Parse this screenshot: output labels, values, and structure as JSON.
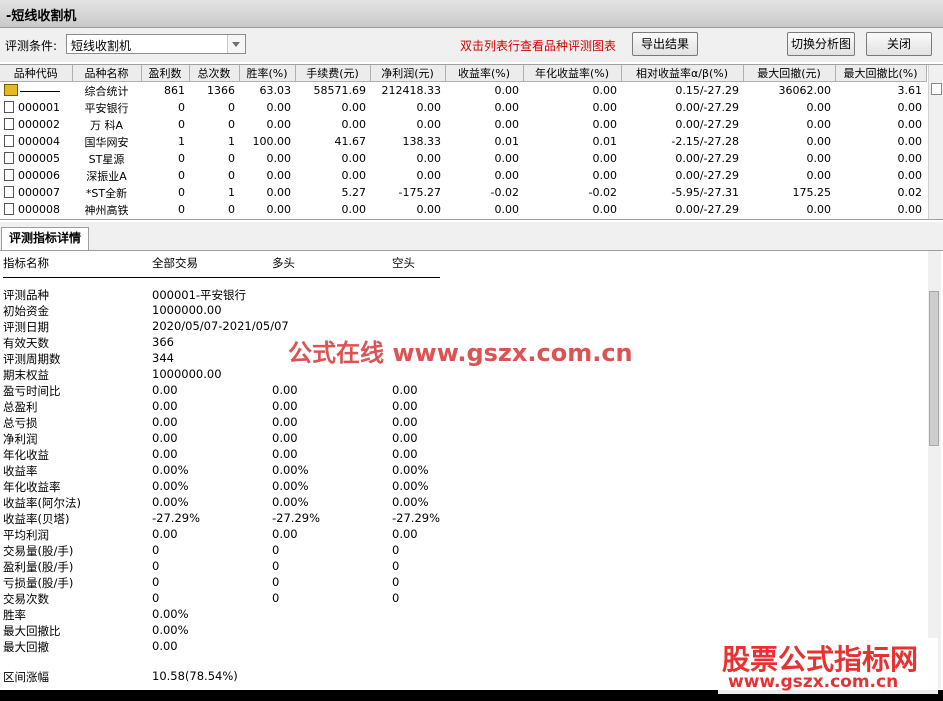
{
  "window": {
    "title": "-短线收割机"
  },
  "toolbar": {
    "condition_label": "评测条件:",
    "condition_value": "短线收割机",
    "hint": "双击列表行查看品种评测图表",
    "export_label": "导出结果",
    "switch_label": "切换分析图",
    "close_label": "关闭"
  },
  "table": {
    "headers": [
      "品种代码",
      "品种名称",
      "盈利数",
      "总次数",
      "胜率(%)",
      "手续费(元)",
      "净利润(元)",
      "收益率(%)",
      "年化收益率(%)",
      "相对收益率α/β(%)",
      "最大回撤(元)",
      "最大回撤比(%)"
    ],
    "rows": [
      [
        "",
        "综合统计",
        "861",
        "1366",
        "63.03",
        "58571.69",
        "212418.33",
        "0.00",
        "0.00",
        "0.15/-27.29",
        "36062.00",
        "3.61"
      ],
      [
        "000001",
        "平安银行",
        "0",
        "0",
        "0.00",
        "0.00",
        "0.00",
        "0.00",
        "0.00",
        "0.00/-27.29",
        "0.00",
        "0.00"
      ],
      [
        "000002",
        "万 科A",
        "0",
        "0",
        "0.00",
        "0.00",
        "0.00",
        "0.00",
        "0.00",
        "0.00/-27.29",
        "0.00",
        "0.00"
      ],
      [
        "000004",
        "国华网安",
        "1",
        "1",
        "100.00",
        "41.67",
        "138.33",
        "0.01",
        "0.01",
        "-2.15/-27.28",
        "0.00",
        "0.00"
      ],
      [
        "000005",
        "ST星源",
        "0",
        "0",
        "0.00",
        "0.00",
        "0.00",
        "0.00",
        "0.00",
        "0.00/-27.29",
        "0.00",
        "0.00"
      ],
      [
        "000006",
        "深振业A",
        "0",
        "0",
        "0.00",
        "0.00",
        "0.00",
        "0.00",
        "0.00",
        "0.00/-27.29",
        "0.00",
        "0.00"
      ],
      [
        "000007",
        "*ST全新",
        "0",
        "1",
        "0.00",
        "5.27",
        "-175.27",
        "-0.02",
        "-0.02",
        "-5.95/-27.31",
        "175.25",
        "0.02"
      ],
      [
        "000008",
        "神州高铁",
        "0",
        "0",
        "0.00",
        "0.00",
        "0.00",
        "0.00",
        "0.00",
        "0.00/-27.29",
        "0.00",
        "0.00"
      ]
    ]
  },
  "detail": {
    "tab_label": "评测指标详情",
    "headers": [
      "指标名称",
      "全部交易",
      "多头",
      "空头"
    ],
    "rows": [
      [
        "评测品种",
        "000001-平安银行",
        "",
        ""
      ],
      [
        "初始资金",
        "1000000.00",
        "",
        ""
      ],
      [
        "评测日期",
        "2020/05/07-2021/05/07",
        "",
        ""
      ],
      [
        "有效天数",
        "366",
        "",
        ""
      ],
      [
        "评测周期数",
        "344",
        "",
        ""
      ],
      [
        "期末权益",
        "1000000.00",
        "",
        ""
      ],
      [
        "盈亏时间比",
        "0.00",
        "0.00",
        "0.00"
      ],
      [
        "总盈利",
        "0.00",
        "0.00",
        "0.00"
      ],
      [
        "总亏损",
        "0.00",
        "0.00",
        "0.00"
      ],
      [
        "净利润",
        "0.00",
        "0.00",
        "0.00"
      ],
      [
        "年化收益",
        "0.00",
        "0.00",
        "0.00"
      ],
      [
        "收益率",
        "0.00%",
        "0.00%",
        "0.00%"
      ],
      [
        "年化收益率",
        "0.00%",
        "0.00%",
        "0.00%"
      ],
      [
        "收益率(阿尔法)",
        "0.00%",
        "0.00%",
        "0.00%"
      ],
      [
        "收益率(贝塔)",
        "-27.29%",
        "-27.29%",
        "-27.29%"
      ],
      [
        "平均利润",
        "0.00",
        "0.00",
        "0.00"
      ],
      [
        "交易量(股/手)",
        "0",
        "0",
        "0"
      ],
      [
        "盈利量(股/手)",
        "0",
        "0",
        "0"
      ],
      [
        "亏损量(股/手)",
        "0",
        "0",
        "0"
      ],
      [
        "交易次数",
        "0",
        "0",
        "0"
      ],
      [
        "胜率",
        "0.00%",
        "",
        ""
      ],
      [
        "最大回撤比",
        "0.00%",
        "",
        ""
      ],
      [
        "最大回撤",
        "0.00",
        "",
        ""
      ],
      [
        "区间涨幅",
        "10.58(78.54%)",
        "",
        ""
      ]
    ]
  },
  "watermark": {
    "center": "公式在线  www.gszx.com.cn",
    "corner_title": "股票公式指标网",
    "corner_url": "www.gszx.com.cn"
  }
}
